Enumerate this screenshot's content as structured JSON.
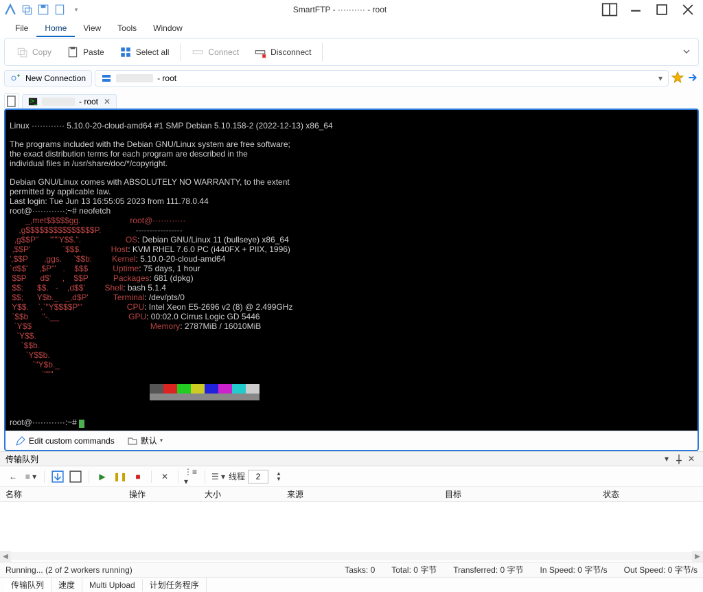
{
  "title": "SmartFTP - ·········· - root",
  "menu": {
    "file": "File",
    "home": "Home",
    "view": "View",
    "tools": "Tools",
    "window": "Window"
  },
  "toolbar": {
    "copy": "Copy",
    "paste": "Paste",
    "select_all": "Select all",
    "connect": "Connect",
    "disconnect": "Disconnect"
  },
  "address": {
    "new_conn": "New Connection",
    "host_suffix": " - root"
  },
  "tab": {
    "label_suffix": " - root"
  },
  "term": {
    "line_linux": "Linux ············ 5.10.0-20-cloud-amd64 #1 SMP Debian 5.10.158-2 (2022-12-13) x86_64",
    "p1": "The programs included with the Debian GNU/Linux system are free software;",
    "p2": "the exact distribution terms for each program are described in the",
    "p3": "individual files in /usr/share/doc/*/copyright.",
    "w1": "Debian GNU/Linux comes with ABSOLUTELY NO WARRANTY, to the extent",
    "w2": "permitted by applicable law.",
    "last": "Last login: Tue Jun 13 16:55:05 2023 from 111.78.0.44",
    "prompt1": "root@············:~# neofetch",
    "nf_user": "root@············",
    "nf_sep": "-----------------",
    "os_k": "OS",
    "os_v": ": Debian GNU/Linux 11 (bullseye) x86_64",
    "host_k": "Host",
    "host_v": ": KVM RHEL 7.6.0 PC (i440FX + PIIX, 1996)",
    "kernel_k": "Kernel",
    "kernel_v": ": 5.10.0-20-cloud-amd64",
    "uptime_k": "Uptime",
    "uptime_v": ": 75 days, 1 hour",
    "pkgs_k": "Packages",
    "pkgs_v": ": 681 (dpkg)",
    "shell_k": "Shell",
    "shell_v": ": bash 5.1.4",
    "term_k": "Terminal",
    "term_v": ": /dev/pts/0",
    "cpu_k": "CPU",
    "cpu_v": ": Intel Xeon E5-2696 v2 (8) @ 2.499GHz",
    "gpu_k": "GPU",
    "gpu_v": ": 00:02.0 Cirrus Logic GD 5446",
    "mem_k": "Memory",
    "mem_v": ": 2787MiB / 16010MiB",
    "ascii01": "       _,met$$$$$gg.",
    "ascii02": "    ,g$$$$$$$$$$$$$$$P.",
    "ascii03": "  ,g$$P\"     \"\"\"Y$$.\".",
    "ascii04": " ,$$P'              `$$$.",
    "ascii05": "',$$P       ,ggs.     `$$b:",
    "ascii06": "`d$$'     ,$P\"'   .    $$$",
    "ascii07": " $$P      d$'     ,    $$P",
    "ascii08": " $$:      $$.   -    ,d$$'",
    "ascii09": " $$;      Y$b._   _,d$P'",
    "ascii10": " Y$$.    `.`\"Y$$$$P\"'",
    "ascii11": " `$$b      \"-.__",
    "ascii12": "  `Y$$",
    "ascii13": "   `Y$$.",
    "ascii14": "     `$$b.",
    "ascii15": "       `Y$$b.",
    "ascii16": "          `\"Y$b._",
    "ascii17": "              `\"\"\"",
    "prompt2_pre": "root@············:~# "
  },
  "substatus": {
    "edit": "Edit custom commands",
    "default": "默认"
  },
  "panel": {
    "title": "传输队列"
  },
  "qtb": {
    "threads": "线程",
    "threads_val": "2"
  },
  "cols": {
    "name": "名称",
    "op": "操作",
    "size": "大小",
    "src": "来源",
    "dst": "目标",
    "st": "状态"
  },
  "status": {
    "running": "Running... (2 of 2 workers running)",
    "tasks": "Tasks: 0",
    "total": "Total: 0 字节",
    "xfer": "Transferred: 0 字节",
    "in": "In Speed: 0 字节/s",
    "out": "Out Speed: 0 字节/s"
  },
  "btabs": {
    "queue": "传输队列",
    "speed": "速度",
    "multi": "Multi Upload",
    "sched": "计划任务程序"
  }
}
